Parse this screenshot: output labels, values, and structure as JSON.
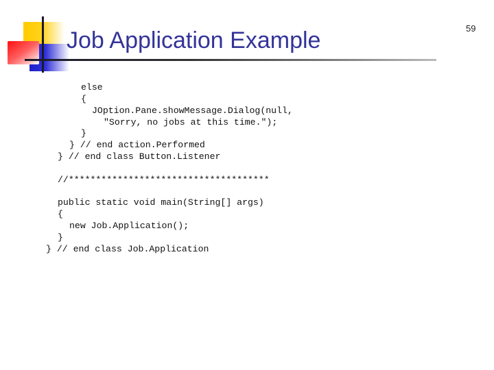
{
  "slide": {
    "title": "Job Application Example",
    "page_number": "59",
    "logo_icon": "overlapping-squares-logo"
  },
  "code": {
    "lines": [
      {
        "indent": 118,
        "text": "else"
      },
      {
        "indent": 118,
        "text": "{"
      },
      {
        "indent": 134,
        "text": "JOption.Pane.showMessage.Dialog(null,"
      },
      {
        "indent": 151,
        "text": "\"Sorry, no jobs at this time.\");"
      },
      {
        "indent": 118,
        "text": "}"
      },
      {
        "indent": 101,
        "text": "} // end action.Performed"
      },
      {
        "indent": 84,
        "text": "} // end class Button.Listener"
      },
      {
        "indent": 84,
        "text": ""
      },
      {
        "indent": 84,
        "text": "//*************************************"
      },
      {
        "indent": 84,
        "text": ""
      },
      {
        "indent": 84,
        "text": "public static void main(String[] args)"
      },
      {
        "indent": 84,
        "text": "{"
      },
      {
        "indent": 101,
        "text": "new Job.Application();"
      },
      {
        "indent": 84,
        "text": "}"
      },
      {
        "indent": 67,
        "text": "} // end class Job.Application"
      }
    ]
  }
}
